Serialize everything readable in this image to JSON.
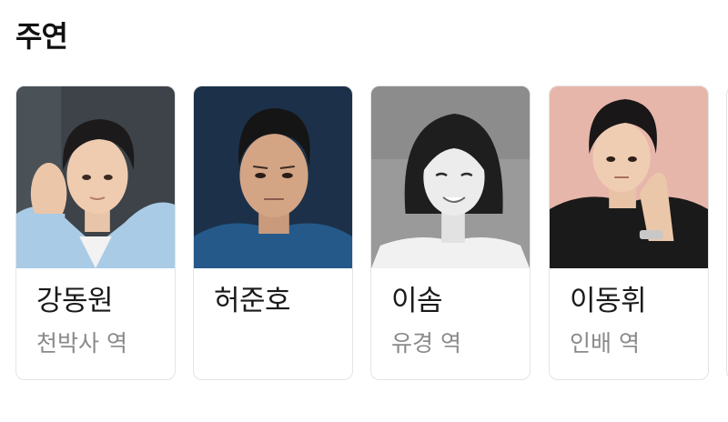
{
  "section": {
    "title": "주연"
  },
  "cast": [
    {
      "name": "강동원",
      "role": "천박사 역",
      "photo_bg": "#3d4348"
    },
    {
      "name": "허준호",
      "role": "",
      "photo_bg": "#1f3650"
    },
    {
      "name": "이솜",
      "role": "유경 역",
      "photo_bg": "#9a9a9a"
    },
    {
      "name": "이동휘",
      "role": "인배 역",
      "photo_bg": "#e7b6ab"
    }
  ]
}
